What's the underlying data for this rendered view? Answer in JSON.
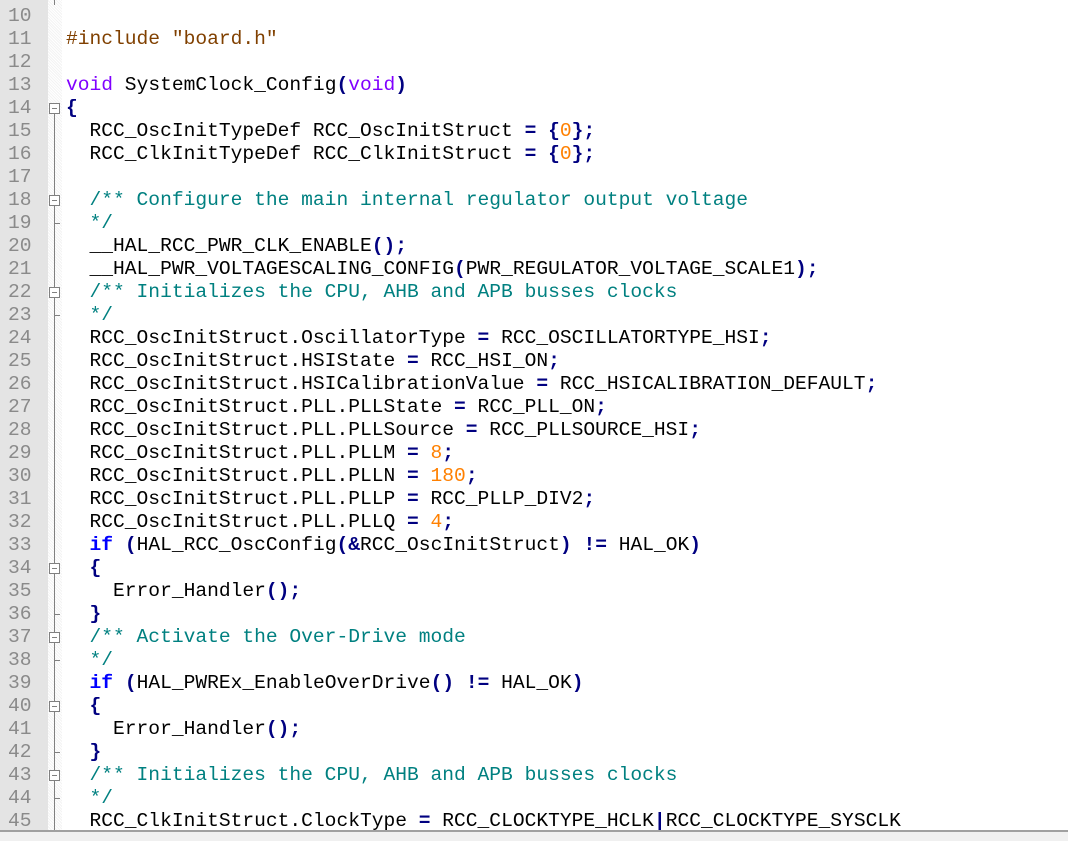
{
  "editor": {
    "colors": {
      "keyword": "#0000ff",
      "type": "#8000ff",
      "operator": "#000080",
      "number": "#ff8000",
      "comment": "#008080",
      "preprocessor": "#804000",
      "line_number": "#8a8a8a",
      "gutter": "#e4e4e4"
    },
    "lines": [
      {
        "n": "",
        "fold": "v",
        "t": [
          [
            "c",
            "  */"
          ]
        ]
      },
      {
        "n": "10",
        "fold": "",
        "t": []
      },
      {
        "n": "11",
        "fold": "",
        "t": [
          [
            "p",
            "#include \"board.h\""
          ]
        ]
      },
      {
        "n": "12",
        "fold": "",
        "t": []
      },
      {
        "n": "13",
        "fold": "",
        "t": [
          [
            "ty",
            "void"
          ],
          [
            "t",
            " SystemClock_Config"
          ],
          [
            "o",
            "("
          ],
          [
            "ty",
            "void"
          ],
          [
            "o",
            ")"
          ]
        ]
      },
      {
        "n": "14",
        "fold": "box0",
        "t": [
          [
            "o",
            "{"
          ]
        ]
      },
      {
        "n": "15",
        "fold": "v",
        "t": [
          [
            "t",
            "  RCC_OscInitTypeDef RCC_OscInitStruct "
          ],
          [
            "o",
            "="
          ],
          [
            "t",
            " "
          ],
          [
            "o",
            "{"
          ],
          [
            "n",
            "0"
          ],
          [
            "o",
            "};"
          ]
        ]
      },
      {
        "n": "16",
        "fold": "v",
        "t": [
          [
            "t",
            "  RCC_ClkInitTypeDef RCC_ClkInitStruct "
          ],
          [
            "o",
            "="
          ],
          [
            "t",
            " "
          ],
          [
            "o",
            "{"
          ],
          [
            "n",
            "0"
          ],
          [
            "o",
            "};"
          ]
        ]
      },
      {
        "n": "17",
        "fold": "v",
        "t": []
      },
      {
        "n": "18",
        "fold": "box",
        "t": [
          [
            "c",
            "  /** Configure the main internal regulator output voltage"
          ]
        ]
      },
      {
        "n": "19",
        "fold": "end",
        "t": [
          [
            "c",
            "  */"
          ]
        ]
      },
      {
        "n": "20",
        "fold": "v",
        "t": [
          [
            "t",
            "  __HAL_RCC_PWR_CLK_ENABLE"
          ],
          [
            "o",
            "();"
          ]
        ]
      },
      {
        "n": "21",
        "fold": "v",
        "t": [
          [
            "t",
            "  __HAL_PWR_VOLTAGESCALING_CONFIG"
          ],
          [
            "o",
            "("
          ],
          [
            "t",
            "PWR_REGULATOR_VOLTAGE_SCALE1"
          ],
          [
            "o",
            ");"
          ]
        ]
      },
      {
        "n": "22",
        "fold": "box",
        "t": [
          [
            "c",
            "  /** Initializes the CPU, AHB and APB busses clocks"
          ]
        ]
      },
      {
        "n": "23",
        "fold": "end",
        "t": [
          [
            "c",
            "  */"
          ]
        ]
      },
      {
        "n": "24",
        "fold": "v",
        "t": [
          [
            "t",
            "  RCC_OscInitStruct.OscillatorType "
          ],
          [
            "o",
            "="
          ],
          [
            "t",
            " RCC_OSCILLATORTYPE_HSI"
          ],
          [
            "o",
            ";"
          ]
        ]
      },
      {
        "n": "25",
        "fold": "v",
        "t": [
          [
            "t",
            "  RCC_OscInitStruct.HSIState "
          ],
          [
            "o",
            "="
          ],
          [
            "t",
            " RCC_HSI_ON"
          ],
          [
            "o",
            ";"
          ]
        ]
      },
      {
        "n": "26",
        "fold": "v",
        "t": [
          [
            "t",
            "  RCC_OscInitStruct.HSICalibrationValue "
          ],
          [
            "o",
            "="
          ],
          [
            "t",
            " RCC_HSICALIBRATION_DEFAULT"
          ],
          [
            "o",
            ";"
          ]
        ]
      },
      {
        "n": "27",
        "fold": "v",
        "t": [
          [
            "t",
            "  RCC_OscInitStruct.PLL.PLLState "
          ],
          [
            "o",
            "="
          ],
          [
            "t",
            " RCC_PLL_ON"
          ],
          [
            "o",
            ";"
          ]
        ]
      },
      {
        "n": "28",
        "fold": "v",
        "t": [
          [
            "t",
            "  RCC_OscInitStruct.PLL.PLLSource "
          ],
          [
            "o",
            "="
          ],
          [
            "t",
            " RCC_PLLSOURCE_HSI"
          ],
          [
            "o",
            ";"
          ]
        ]
      },
      {
        "n": "29",
        "fold": "v",
        "t": [
          [
            "t",
            "  RCC_OscInitStruct.PLL.PLLM "
          ],
          [
            "o",
            "="
          ],
          [
            "t",
            " "
          ],
          [
            "n",
            "8"
          ],
          [
            "o",
            ";"
          ]
        ]
      },
      {
        "n": "30",
        "fold": "v",
        "t": [
          [
            "t",
            "  RCC_OscInitStruct.PLL.PLLN "
          ],
          [
            "o",
            "="
          ],
          [
            "t",
            " "
          ],
          [
            "n",
            "180"
          ],
          [
            "o",
            ";"
          ]
        ]
      },
      {
        "n": "31",
        "fold": "v",
        "t": [
          [
            "t",
            "  RCC_OscInitStruct.PLL.PLLP "
          ],
          [
            "o",
            "="
          ],
          [
            "t",
            " RCC_PLLP_DIV2"
          ],
          [
            "o",
            ";"
          ]
        ]
      },
      {
        "n": "32",
        "fold": "v",
        "t": [
          [
            "t",
            "  RCC_OscInitStruct.PLL.PLLQ "
          ],
          [
            "o",
            "="
          ],
          [
            "t",
            " "
          ],
          [
            "n",
            "4"
          ],
          [
            "o",
            ";"
          ]
        ]
      },
      {
        "n": "33",
        "fold": "v",
        "t": [
          [
            "t",
            "  "
          ],
          [
            "k",
            "if"
          ],
          [
            "t",
            " "
          ],
          [
            "o",
            "("
          ],
          [
            "t",
            "HAL_RCC_OscConfig"
          ],
          [
            "o",
            "(&"
          ],
          [
            "t",
            "RCC_OscInitStruct"
          ],
          [
            "o",
            ")"
          ],
          [
            "t",
            " "
          ],
          [
            "o",
            "!="
          ],
          [
            "t",
            " HAL_OK"
          ],
          [
            "o",
            ")"
          ]
        ]
      },
      {
        "n": "34",
        "fold": "box",
        "t": [
          [
            "t",
            "  "
          ],
          [
            "o",
            "{"
          ]
        ]
      },
      {
        "n": "35",
        "fold": "v",
        "t": [
          [
            "t",
            "    Error_Handler"
          ],
          [
            "o",
            "();"
          ]
        ]
      },
      {
        "n": "36",
        "fold": "end",
        "t": [
          [
            "t",
            "  "
          ],
          [
            "o",
            "}"
          ]
        ]
      },
      {
        "n": "37",
        "fold": "box",
        "t": [
          [
            "c",
            "  /** Activate the Over-Drive mode"
          ]
        ]
      },
      {
        "n": "38",
        "fold": "end",
        "t": [
          [
            "c",
            "  */"
          ]
        ]
      },
      {
        "n": "39",
        "fold": "v",
        "t": [
          [
            "t",
            "  "
          ],
          [
            "k",
            "if"
          ],
          [
            "t",
            " "
          ],
          [
            "o",
            "("
          ],
          [
            "t",
            "HAL_PWREx_EnableOverDrive"
          ],
          [
            "o",
            "()"
          ],
          [
            "t",
            " "
          ],
          [
            "o",
            "!="
          ],
          [
            "t",
            " HAL_OK"
          ],
          [
            "o",
            ")"
          ]
        ]
      },
      {
        "n": "40",
        "fold": "box",
        "t": [
          [
            "t",
            "  "
          ],
          [
            "o",
            "{"
          ]
        ]
      },
      {
        "n": "41",
        "fold": "v",
        "t": [
          [
            "t",
            "    Error_Handler"
          ],
          [
            "o",
            "();"
          ]
        ]
      },
      {
        "n": "42",
        "fold": "end",
        "t": [
          [
            "t",
            "  "
          ],
          [
            "o",
            "}"
          ]
        ]
      },
      {
        "n": "43",
        "fold": "box",
        "t": [
          [
            "c",
            "  /** Initializes the CPU, AHB and APB busses clocks"
          ]
        ]
      },
      {
        "n": "44",
        "fold": "end",
        "t": [
          [
            "c",
            "  */"
          ]
        ]
      },
      {
        "n": "45",
        "fold": "v",
        "t": [
          [
            "t",
            "  RCC_ClkInitStruct.ClockType "
          ],
          [
            "o",
            "="
          ],
          [
            "t",
            " RCC_CLOCKTYPE_HCLK"
          ],
          [
            "o",
            "|"
          ],
          [
            "t",
            "RCC_CLOCKTYPE_SYSCLK"
          ]
        ]
      }
    ]
  }
}
